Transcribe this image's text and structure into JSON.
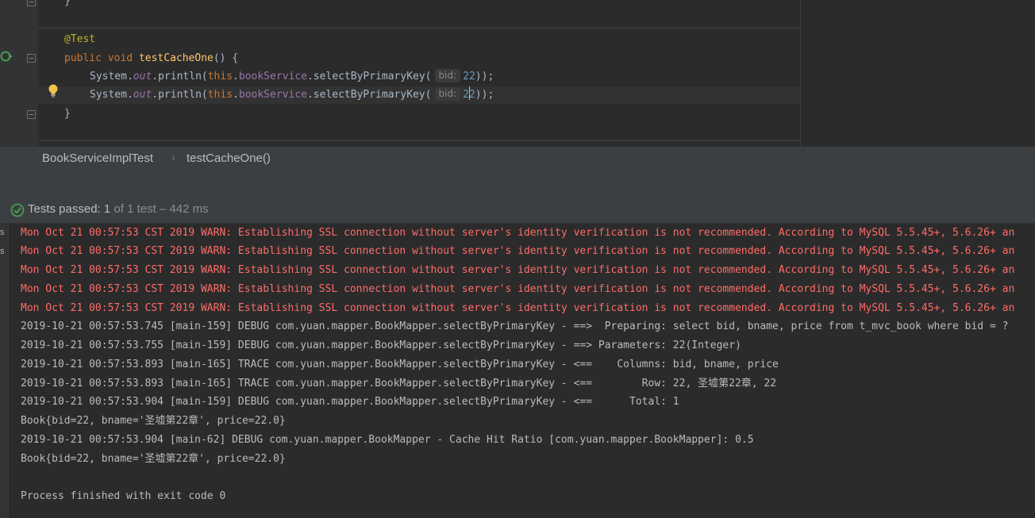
{
  "editor": {
    "lines": {
      "close_brace_top": "}",
      "annotation": "@Test",
      "kw_public": "public",
      "kw_void": "void",
      "method_name": "testCacheOne",
      "method_sig_tail": "() {",
      "stmt1_prefix": "System.",
      "stmt_out": "out",
      "stmt_println": ".println(",
      "kw_this": "this",
      "dot": ".",
      "field_book_service": "bookService",
      "call_select": ".selectByPrimaryKey(",
      "param_hint": "bid:",
      "arg_value": "22",
      "stmt_tail": "));",
      "arg_value_a": "2",
      "arg_value_b": "2",
      "close_brace_bottom": "}"
    }
  },
  "breadcrumb": {
    "class_name": "BookServiceImplTest",
    "method_name": "testCacheOne()"
  },
  "test_status": {
    "label": "Tests passed:",
    "passed": "1",
    "detail": "of 1 test – 442 ms"
  },
  "console": {
    "gutter_label": "s",
    "lines": [
      {
        "kind": "warn",
        "text": "Mon Oct 21 00:57:53 CST 2019 WARN: Establishing SSL connection without server's identity verification is not recommended. According to MySQL 5.5.45+, 5.6.26+ an"
      },
      {
        "kind": "warn",
        "text": "Mon Oct 21 00:57:53 CST 2019 WARN: Establishing SSL connection without server's identity verification is not recommended. According to MySQL 5.5.45+, 5.6.26+ an"
      },
      {
        "kind": "warn",
        "text": "Mon Oct 21 00:57:53 CST 2019 WARN: Establishing SSL connection without server's identity verification is not recommended. According to MySQL 5.5.45+, 5.6.26+ an"
      },
      {
        "kind": "warn",
        "text": "Mon Oct 21 00:57:53 CST 2019 WARN: Establishing SSL connection without server's identity verification is not recommended. According to MySQL 5.5.45+, 5.6.26+ an"
      },
      {
        "kind": "warn",
        "text": "Mon Oct 21 00:57:53 CST 2019 WARN: Establishing SSL connection without server's identity verification is not recommended. According to MySQL 5.5.45+, 5.6.26+ an"
      },
      {
        "kind": "info",
        "text": "2019-10-21 00:57:53.745 [main-159] DEBUG com.yuan.mapper.BookMapper.selectByPrimaryKey - ==>  Preparing: select bid, bname, price from t_mvc_book where bid = ?"
      },
      {
        "kind": "info",
        "text": "2019-10-21 00:57:53.755 [main-159] DEBUG com.yuan.mapper.BookMapper.selectByPrimaryKey - ==> Parameters: 22(Integer)"
      },
      {
        "kind": "info",
        "text": "2019-10-21 00:57:53.893 [main-165] TRACE com.yuan.mapper.BookMapper.selectByPrimaryKey - <==    Columns: bid, bname, price"
      },
      {
        "kind": "info",
        "text": "2019-10-21 00:57:53.893 [main-165] TRACE com.yuan.mapper.BookMapper.selectByPrimaryKey - <==        Row: 22, 圣墟第22章, 22"
      },
      {
        "kind": "info",
        "text": "2019-10-21 00:57:53.904 [main-159] DEBUG com.yuan.mapper.BookMapper.selectByPrimaryKey - <==      Total: 1"
      },
      {
        "kind": "info",
        "text": "Book{bid=22, bname='圣墟第22章', price=22.0}"
      },
      {
        "kind": "info",
        "text": "2019-10-21 00:57:53.904 [main-62] DEBUG com.yuan.mapper.BookMapper - Cache Hit Ratio [com.yuan.mapper.BookMapper]: 0.5"
      },
      {
        "kind": "info",
        "text": "Book{bid=22, bname='圣墟第22章', price=22.0}"
      },
      {
        "kind": "info",
        "text": ""
      },
      {
        "kind": "info",
        "text": "Process finished with exit code 0"
      }
    ]
  },
  "colors": {
    "warn": "#ff6b68",
    "pass": "#499c54",
    "background": "#2b2b2b"
  },
  "icons": [
    "run-test-icon",
    "fold-icon",
    "lightbulb-icon",
    "check-circle-icon",
    "chevron-right-icon"
  ]
}
